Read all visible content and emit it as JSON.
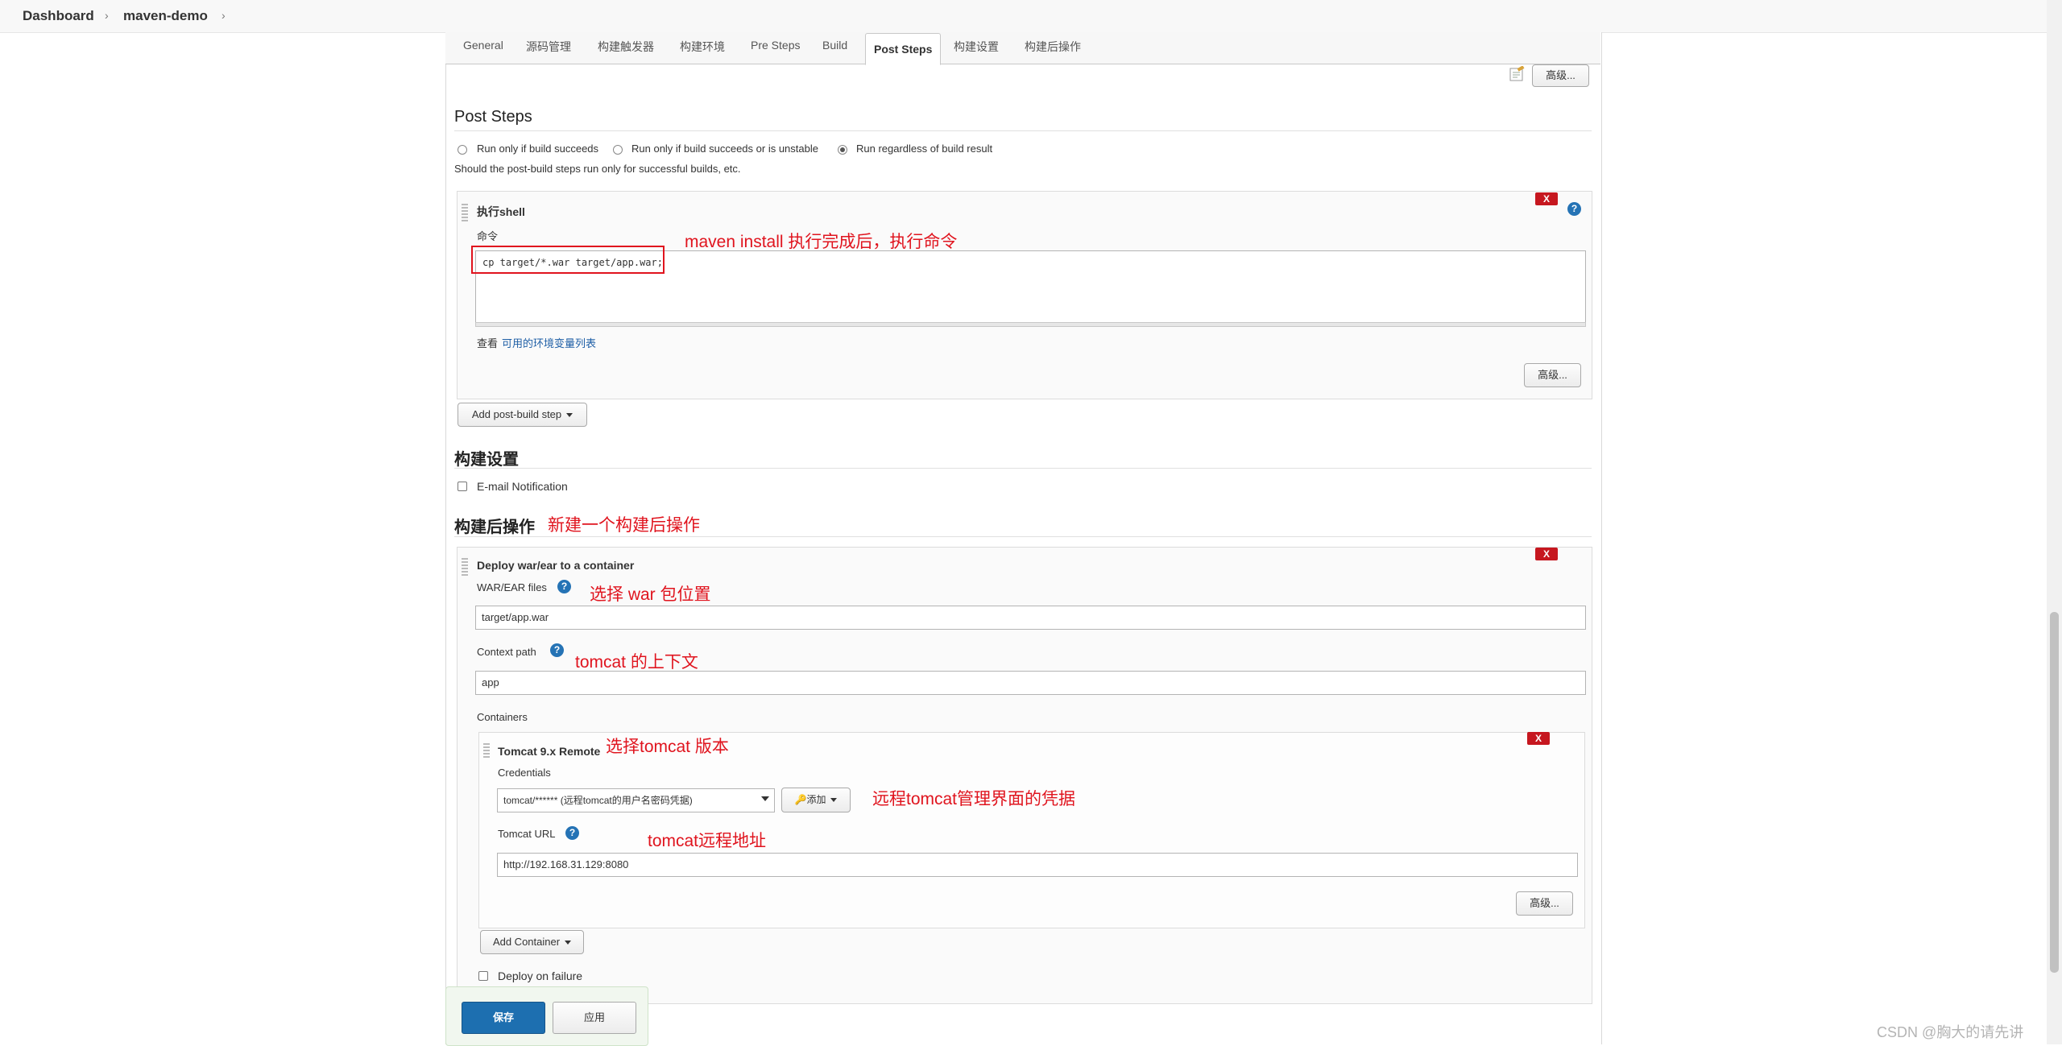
{
  "breadcrumb": {
    "items": [
      "Dashboard",
      "maven-demo"
    ]
  },
  "tabs": [
    "General",
    "源码管理",
    "构建触发器",
    "构建环境",
    "Pre Steps",
    "Build",
    "Post Steps",
    "构建设置",
    "构建后操作"
  ],
  "active_tab": "Post Steps",
  "advanced_label": "高级...",
  "post_steps": {
    "title": "Post Steps",
    "radio_options": [
      "Run only if build succeeds",
      "Run only if build succeeds or is unstable",
      "Run regardless of build result"
    ],
    "selected_option": "Run regardless of build result",
    "description": "Should the post-build steps run only for successful builds, etc.",
    "shell": {
      "title": "执行shell",
      "command_label": "命令",
      "command_value": "cp target/*.war target/app.war;",
      "env_prefix": "查看",
      "env_link": "可用的环境变量列表"
    },
    "add_step_label": "Add post-build step"
  },
  "build_settings": {
    "title": "构建设置",
    "email_label": "E-mail Notification"
  },
  "post_build": {
    "title": "构建后操作",
    "deploy": {
      "title": "Deploy war/ear to a container",
      "war_label": "WAR/EAR files",
      "war_value": "target/app.war",
      "context_label": "Context path",
      "context_value": "app",
      "containers_label": "Containers",
      "tomcat": {
        "title": "Tomcat 9.x Remote",
        "credentials_label": "Credentials",
        "credentials_value": "tomcat/****** (远程tomcat的用户名密码凭据)",
        "add_label": "添加",
        "url_label": "Tomcat URL",
        "url_value": "http://192.168.31.129:8080"
      },
      "add_container_label": "Add Container",
      "deploy_failure_label": "Deploy on failure"
    }
  },
  "footer": {
    "save_label": "保存",
    "apply_label": "应用"
  },
  "annotations": {
    "maven_install": "maven install 执行完成后，执行命令",
    "new_post_build": "新建一个构建后操作",
    "war_location": "选择 war 包位置",
    "tomcat_context": "tomcat 的上下文",
    "tomcat_version": "选择tomcat 版本",
    "remote_credentials": "远程tomcat管理界面的凭据",
    "tomcat_remote_address": "tomcat远程地址"
  },
  "watermark": "CSDN @胸大的请先讲",
  "colors": {
    "annotation_red": "#e0141e",
    "delete_red": "#c6171f",
    "help_blue": "#2573b5",
    "save_blue": "#1d6fb0"
  },
  "icons": [
    "chevron-right-icon",
    "notepad-icon",
    "drag-handle-icon",
    "delete-icon",
    "help-icon",
    "key-icon",
    "caret-down-icon"
  ]
}
